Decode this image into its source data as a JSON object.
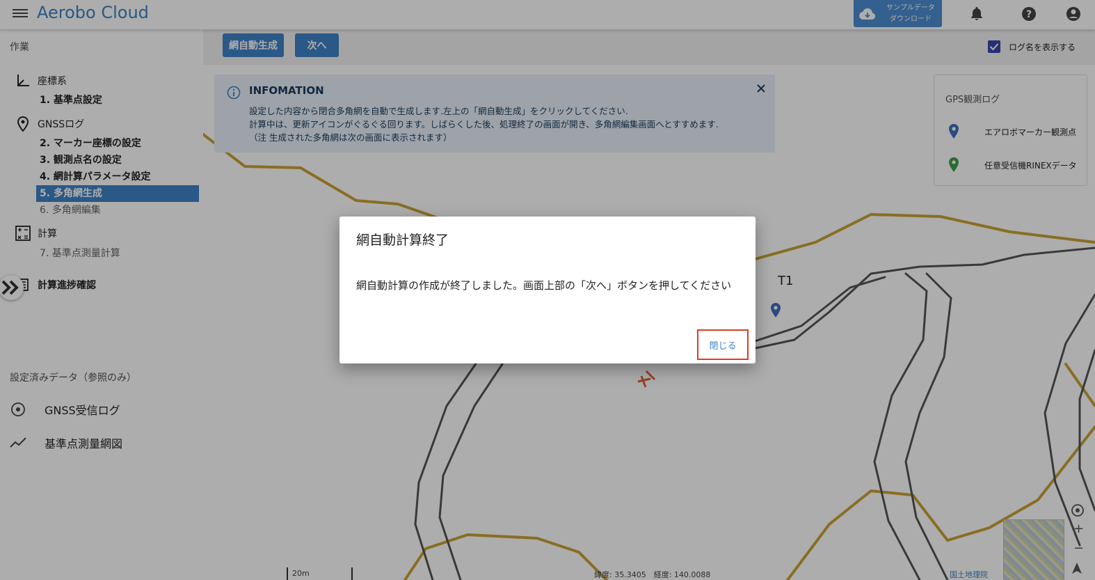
{
  "header": {
    "app_title": "Aerobo Cloud",
    "sample_download_line1": "サンプルデータ",
    "sample_download_line2": "ダウンロード"
  },
  "sidebar": {
    "work_heading": "作業",
    "groups": {
      "coordinate": "座標系",
      "gnss_log": "GNSSログ",
      "calculation": "計算",
      "progress": "計算進捗確認"
    },
    "steps": [
      "1. 基準点設定",
      "2. マーカー座標の設定",
      "3. 観測点名の設定",
      "4. 網計算パラメータ設定",
      "5. 多角網生成",
      "6. 多角網編集",
      "7. 基準点測量計算"
    ],
    "configured_heading": "設定済みデータ（参照のみ）",
    "ref_items": [
      "GNSS受信ログ",
      "基準点測量網図"
    ]
  },
  "toolbar": {
    "auto_generate_label": "網自動生成",
    "next_label": "次へ",
    "show_log_name_label": "ログ名を表示する"
  },
  "info": {
    "title": "INFOMATION",
    "line1": "設定した内容から閉合多角網を自動で生成します.左上の「網自動生成」をクリックしてください.",
    "line2": "計算中は、更新アイコンがぐるぐる回ります。しばらくした後、処理終了の画面が開き、多角網編集画面へとすすめます.",
    "line3": "（注 生成された多角網は次の画面に表示されます）"
  },
  "legend": {
    "title": "GPS観測ログ",
    "items": [
      "エアロボマーカー観測点",
      "任意受信機RINEXデータ"
    ]
  },
  "map": {
    "point_label": "T1",
    "scale": "20m",
    "coords": "緯度: 35.3405　経度: 140.0088",
    "attribution": "国土地理院",
    "zoom_in": "+",
    "zoom_out": "−"
  },
  "dialog": {
    "title": "網自動計算終了",
    "message": "網自動計算の作成が終了しました。画面上部の「次へ」ボタンを押してください",
    "close_label": "閉じる"
  },
  "colors": {
    "brand": "#3d82c4",
    "primary": "#3f82c7",
    "highlight": "#e03b24",
    "road_yellow": "#c9a233",
    "road_gray": "#555555"
  }
}
